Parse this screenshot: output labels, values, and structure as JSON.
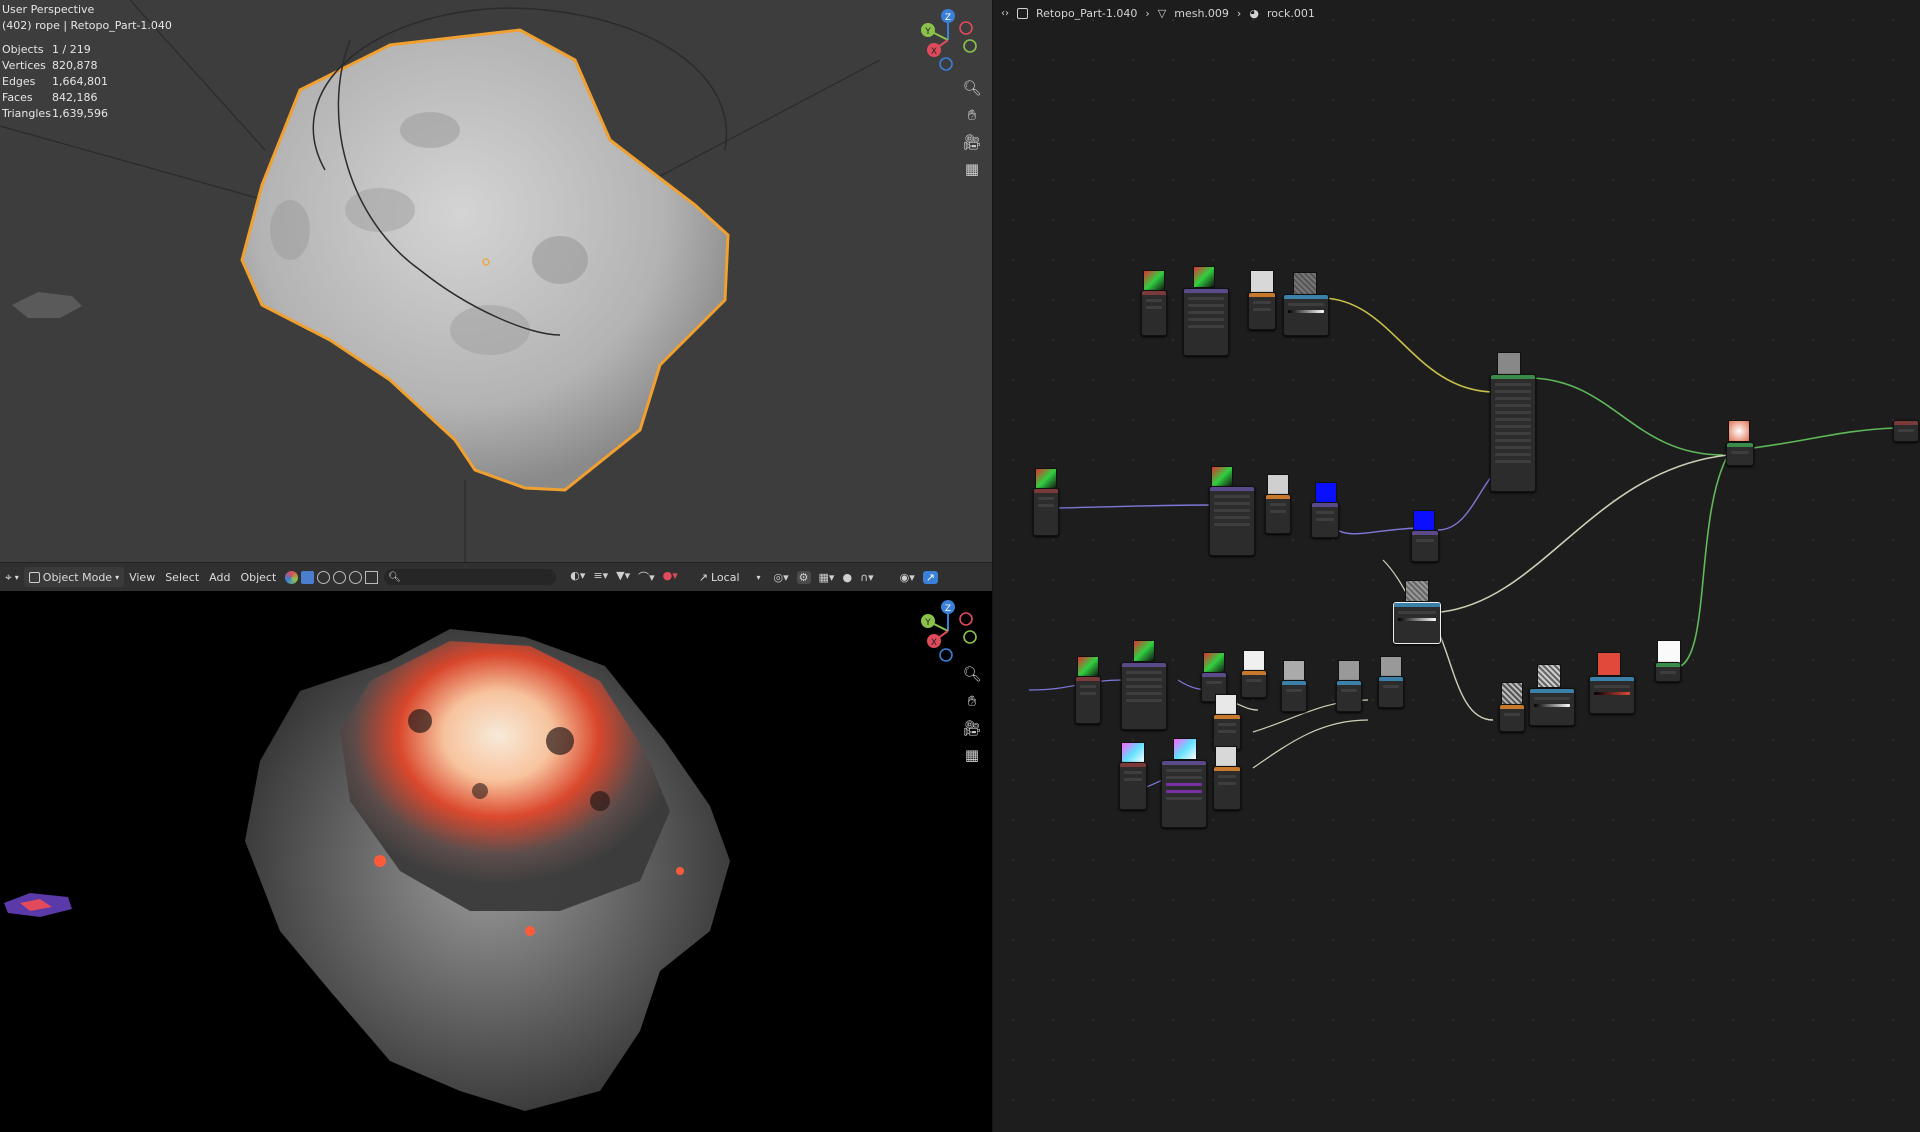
{
  "viewport_top": {
    "perspective": "User Perspective",
    "object_info": "(402) rope | Retopo_Part-1.040",
    "stats": [
      {
        "label": "Objects",
        "value": "1 / 219"
      },
      {
        "label": "Vertices",
        "value": "820,878"
      },
      {
        "label": "Edges",
        "value": "1,664,801"
      },
      {
        "label": "Faces",
        "value": "842,186"
      },
      {
        "label": "Triangles",
        "value": "1,639,596"
      }
    ],
    "gizmo": {
      "z": "Z",
      "y": "Y",
      "x": "X"
    }
  },
  "header": {
    "mode": "Object Mode",
    "menu": [
      "View",
      "Select",
      "Add",
      "Object"
    ],
    "orientation": "Local"
  },
  "viewport_bottom": {
    "gizmo": {
      "z": "Z",
      "y": "Y",
      "x": "X"
    }
  },
  "node_editor": {
    "breadcrumb": [
      "Retopo_Part-1.040",
      "mesh.009",
      "rock.001"
    ]
  },
  "colors": {
    "selection_outline": "#f0a030",
    "axis_x": "#e04a5a",
    "axis_y": "#8bc34a",
    "axis_z": "#3a7fd8",
    "link_yellow": "#c9c04a",
    "link_green": "#5fb85a",
    "link_purple": "#7d78d8",
    "link_grey": "#cfcfb8"
  }
}
